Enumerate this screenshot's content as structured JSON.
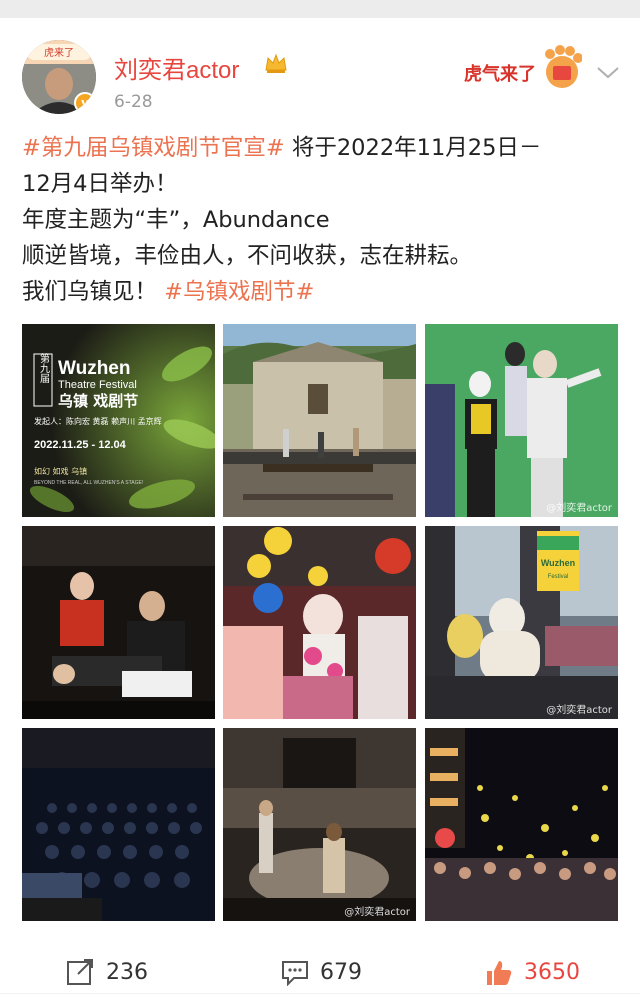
{
  "post": {
    "username": "刘奕君actor",
    "date": "6-28",
    "avatar_label": "虎来了",
    "tiger_badge": "虎气来了",
    "text": {
      "hashtag1": "#第九届乌镇戏剧节官宣#",
      "line1_rest": " 将于2022年11月25日－",
      "line2": "12月4日举办！",
      "line3": "年度主题为“丰”，Abundance",
      "line4": "顺逆皆境，丰俭由人，不问收获，志在耕耘。",
      "line5_prefix": "我们乌镇见！ ",
      "hashtag2": "#乌镇戏剧节#"
    }
  },
  "poster": {
    "vertical": "第九届",
    "brand": "Wuzhen",
    "subtitle": "Theatre Festival",
    "cn_title": "乌镇 戏剧节",
    "sponsors": "发起人：陈向宏 黄磊 赖声川 孟京辉",
    "dates": "2022.11.25 - 12.04",
    "slogan": "如幻 如戏 乌镇",
    "slogan_en": "BEYOND THE REAL, ALL WUZHEN'S A STAGE!"
  },
  "flag": {
    "brand": "Wuzhen",
    "sub": "Festival"
  },
  "watermarks": {
    "w3": "@刘奕君actor",
    "w4": "",
    "w6": "@刘奕君actor",
    "w8": "@刘奕君actor"
  },
  "footer": {
    "reposts": "236",
    "comments": "679",
    "likes": "3650"
  },
  "colors": {
    "accent": "#e8473f",
    "hashtag": "#eb7350"
  }
}
